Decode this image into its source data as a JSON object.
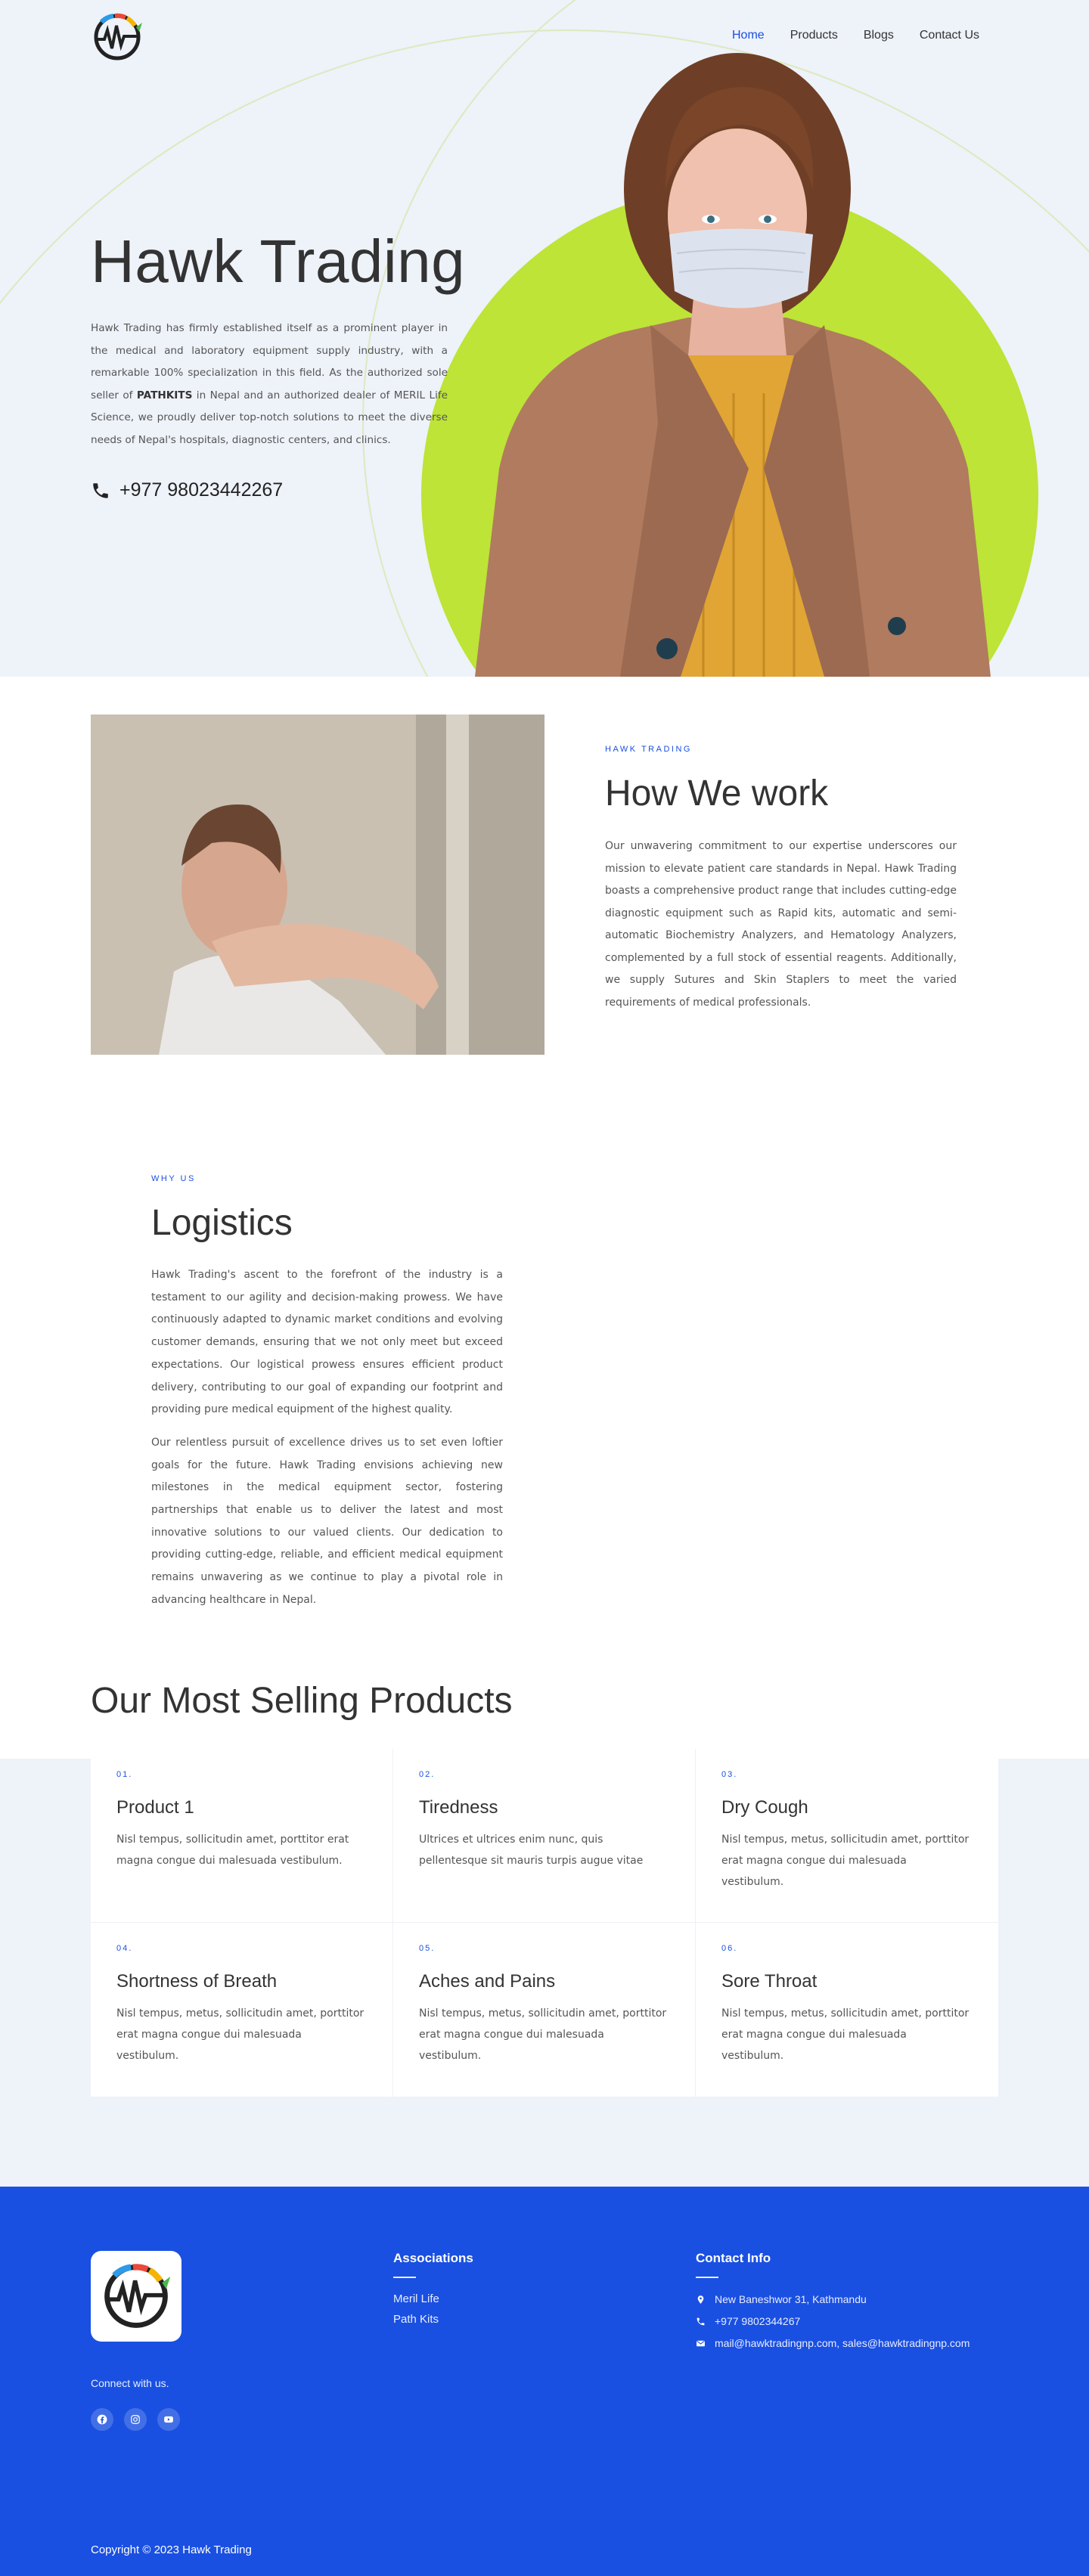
{
  "nav": {
    "items": [
      {
        "label": "Home",
        "active": true
      },
      {
        "label": "Products",
        "active": false
      },
      {
        "label": "Blogs",
        "active": false
      },
      {
        "label": "Contact Us",
        "active": false
      }
    ]
  },
  "hero": {
    "title": "Hawk Trading",
    "text_a": "Hawk Trading has firmly established itself as a prominent player in the medical and laboratory equipment supply industry, with a remarkable 100% specialization in this field. As the authorized sole seller of ",
    "text_strong": "PATHKITS",
    "text_b": " in Nepal and an authorized dealer of MERIL Life Science, we proudly deliver top-notch solutions to meet the diverse needs of Nepal's hospitals, diagnostic centers, and clinics.",
    "phone": "+977 98023442267",
    "accent_color": "#bde436"
  },
  "work": {
    "eyebrow": "HAWK TRADING",
    "title": "How We work",
    "text": "Our unwavering commitment to our expertise underscores our mission to elevate patient care standards in Nepal. Hawk Trading boasts a comprehensive product range that includes cutting-edge diagnostic equipment such as Rapid kits, automatic and semi-automatic Biochemistry Analyzers, and Hematology Analyzers, complemented by a full stock of essential reagents. Additionally, we supply Sutures and Skin Staplers to meet the varied requirements of medical professionals."
  },
  "logistics": {
    "eyebrow": "WHY US",
    "title": "Logistics",
    "p1": "Hawk Trading's ascent to the forefront of the industry is a testament to our agility and decision-making prowess. We have continuously adapted to dynamic market conditions and evolving customer demands, ensuring that we not only meet but exceed expectations. Our logistical prowess ensures efficient product delivery, contributing to our goal of expanding our footprint and providing pure medical equipment of the highest quality.",
    "p2": " Our relentless pursuit of excellence drives us to set even loftier goals for the future. Hawk Trading envisions achieving new milestones in the medical equipment sector, fostering partnerships that enable us to deliver the latest and most innovative solutions to our valued clients. Our dedication to providing cutting-edge, reliable, and efficient medical equipment remains unwavering as we continue to play a pivotal role in advancing healthcare in Nepal."
  },
  "products": {
    "title": "Our Most Selling Products",
    "items": [
      {
        "num": "01.",
        "title": "Product 1",
        "desc": "Nisl tempus, sollicitudin amet, porttitor erat magna congue dui malesuada vestibulum."
      },
      {
        "num": "02.",
        "title": "Tiredness",
        "desc": "Ultrices et ultrices enim nunc, quis pellentesque sit mauris turpis augue vitae"
      },
      {
        "num": "03.",
        "title": "Dry Cough",
        "desc": "Nisl tempus, metus, sollicitudin amet, porttitor erat magna congue dui malesuada vestibulum."
      },
      {
        "num": "04.",
        "title": "Shortness of Breath",
        "desc": "Nisl tempus, metus, sollicitudin amet, porttitor erat magna congue dui malesuada vestibulum."
      },
      {
        "num": "05.",
        "title": "Aches and Pains",
        "desc": "Nisl tempus, metus, sollicitudin amet, porttitor erat magna congue dui malesuada vestibulum."
      },
      {
        "num": "06.",
        "title": "Sore Throat",
        "desc": "Nisl tempus, metus, sollicitudin amet, porttitor erat magna congue dui malesuada vestibulum."
      }
    ]
  },
  "footer": {
    "connect": "Connect with us.",
    "social": [
      "facebook-icon",
      "instagram-icon",
      "youtube-icon"
    ],
    "associations": {
      "heading": "Associations",
      "links": [
        "Meril Life",
        "Path Kits"
      ]
    },
    "contact": {
      "heading": "Contact Info",
      "address": "New Baneshwor 31, Kathmandu",
      "phone": "+977 9802344267",
      "email": "mail@hawktradingnp.com, sales@hawktradingnp.com"
    },
    "copyright": "Copyright © 2023 Hawk Trading",
    "bg_color": "#1a50e1"
  }
}
